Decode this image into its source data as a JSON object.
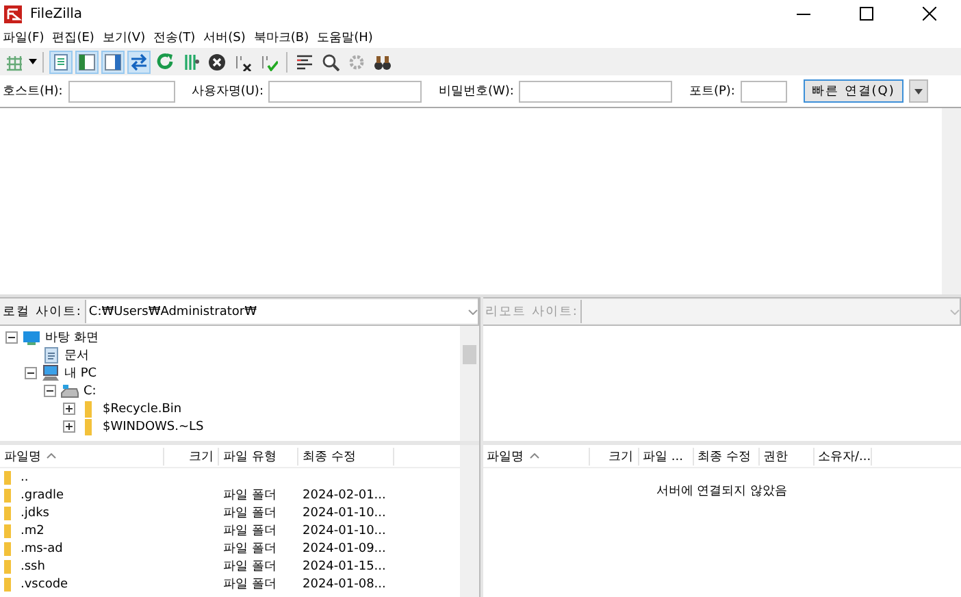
{
  "window": {
    "title": "FileZilla"
  },
  "menu": [
    "파일(F)",
    "편집(E)",
    "보기(V)",
    "전송(T)",
    "서버(S)",
    "북마크(B)",
    "도움말(H)"
  ],
  "toolbar": {
    "toggles": [
      {
        "on": true
      },
      {
        "on": true
      },
      {
        "on": true
      },
      {
        "on": true
      }
    ]
  },
  "quickconnect": {
    "fields": [
      {
        "label": "호스트(H):"
      },
      {
        "label": "사용자명(U):"
      },
      {
        "label": "비밀번호(W):"
      },
      {
        "label": "포트(P):"
      }
    ],
    "button": "빠른 연결(Q)"
  },
  "local": {
    "site_label": "로컬 사이트:",
    "path": "C:₩Users₩Administrator₩",
    "tree": [
      {
        "label": "바탕 화면",
        "kind": "desktop",
        "expanded": true,
        "children": [
          {
            "label": "문서",
            "kind": "document"
          },
          {
            "label": "내 PC",
            "kind": "computer",
            "expanded": true,
            "children": [
              {
                "label": "C:",
                "kind": "drive",
                "expanded": true,
                "children": [
                  {
                    "label": "$Recycle.Bin",
                    "kind": "folder",
                    "expanded": false
                  },
                  {
                    "label": "$WINDOWS.~LS",
                    "kind": "folder",
                    "expanded": false
                  }
                ]
              }
            ]
          }
        ]
      }
    ],
    "columns": [
      "파일명",
      "크기",
      "파일 유형",
      "최종 수정"
    ],
    "rows": [
      {
        "name": ".."
      },
      {
        "name": ".gradle",
        "type": "파일 폴더",
        "modified": "2024-02-01..."
      },
      {
        "name": ".jdks",
        "type": "파일 폴더",
        "modified": "2024-01-10..."
      },
      {
        "name": ".m2",
        "type": "파일 폴더",
        "modified": "2024-01-10..."
      },
      {
        "name": ".ms-ad",
        "type": "파일 폴더",
        "modified": "2024-01-09..."
      },
      {
        "name": ".ssh",
        "type": "파일 폴더",
        "modified": "2024-01-15..."
      },
      {
        "name": ".vscode",
        "type": "파일 폴더",
        "modified": "2024-01-08..."
      }
    ]
  },
  "remote": {
    "site_label": "리모트 사이트:",
    "disabled": true,
    "columns": [
      "파일명",
      "크기",
      "파일 ...",
      "최종 수정",
      "권한",
      "소유자/..."
    ],
    "message": "서버에 연결되지 않았음"
  }
}
